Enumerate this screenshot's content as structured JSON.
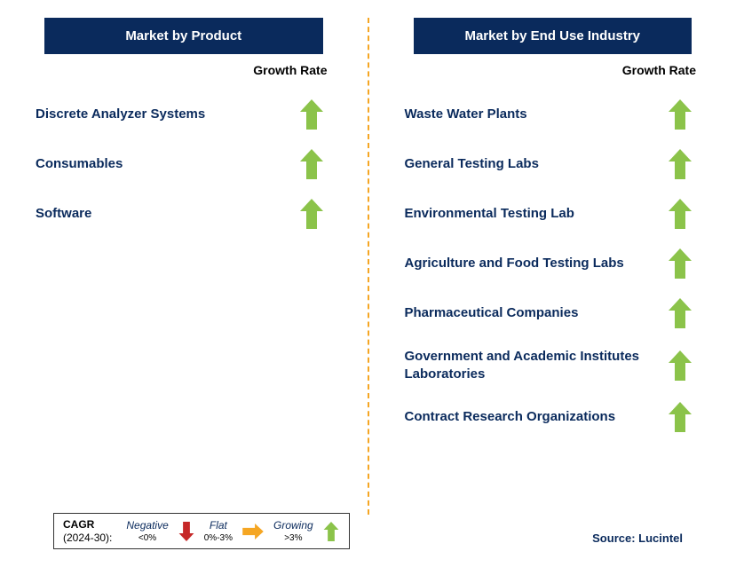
{
  "leftHeader": "Market by Product",
  "rightHeader": "Market by End Use Industry",
  "growthRateLabel": "Growth Rate",
  "leftItems": [
    {
      "label": "Discrete Analyzer Systems",
      "growth": "growing"
    },
    {
      "label": "Consumables",
      "growth": "growing"
    },
    {
      "label": "Software",
      "growth": "growing"
    }
  ],
  "rightItems": [
    {
      "label": "Waste Water Plants",
      "growth": "growing"
    },
    {
      "label": "General Testing Labs",
      "growth": "growing"
    },
    {
      "label": "Environmental Testing Lab",
      "growth": "growing"
    },
    {
      "label": "Agriculture and Food Testing Labs",
      "growth": "growing"
    },
    {
      "label": "Pharmaceutical Companies",
      "growth": "growing"
    },
    {
      "label": "Government and Academic Institutes Laboratories",
      "growth": "growing"
    },
    {
      "label": "Contract Research Organizations",
      "growth": "growing"
    }
  ],
  "legend": {
    "title1": "CAGR",
    "title2": "(2024-30):",
    "negative": "Negative",
    "negativeSub": "<0%",
    "flat": "Flat",
    "flatSub": "0%-3%",
    "growing": "Growing",
    "growingSub": ">3%"
  },
  "source": "Source: Lucintel"
}
